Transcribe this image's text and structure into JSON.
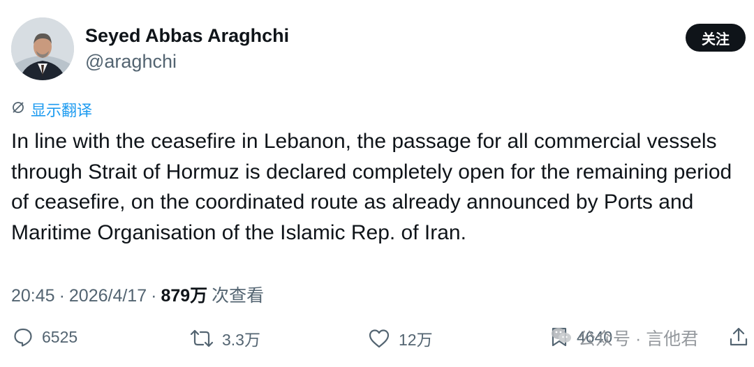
{
  "author": {
    "name": "Seyed Abbas Araghchi",
    "handle": "@araghchi"
  },
  "follow_button": {
    "label": "关注"
  },
  "translate": {
    "label": "显示翻译"
  },
  "tweet": {
    "text": "In line with the ceasefire in Lebanon, the passage for all commercial vessels through Strait of Hormuz is declared completely open for the remaining period of ceasefire, on the coordinated route as already announced by Ports and Maritime Organisation of the Islamic Rep. of Iran."
  },
  "meta": {
    "time": "20:45",
    "date": "2026/4/17",
    "views_count": "879万",
    "views_label": "次查看",
    "separator": "·"
  },
  "actions": {
    "replies": "6525",
    "reposts": "3.3万",
    "likes": "12万",
    "bookmarks": "4640"
  },
  "watermark": {
    "text": "公众号 · 言他君"
  },
  "icons": {
    "translate": "globe-slash-icon",
    "reply": "speech-bubble-icon",
    "repost": "repost-arrows-icon",
    "like": "heart-icon",
    "bookmark": "bookmark-icon",
    "share": "share-upload-icon",
    "watermark": "wechat-icon"
  },
  "colors": {
    "text": "#0f1419",
    "secondary": "#536471",
    "link": "#1d9bf0",
    "button_bg": "#0f1419",
    "button_text": "#ffffff"
  }
}
